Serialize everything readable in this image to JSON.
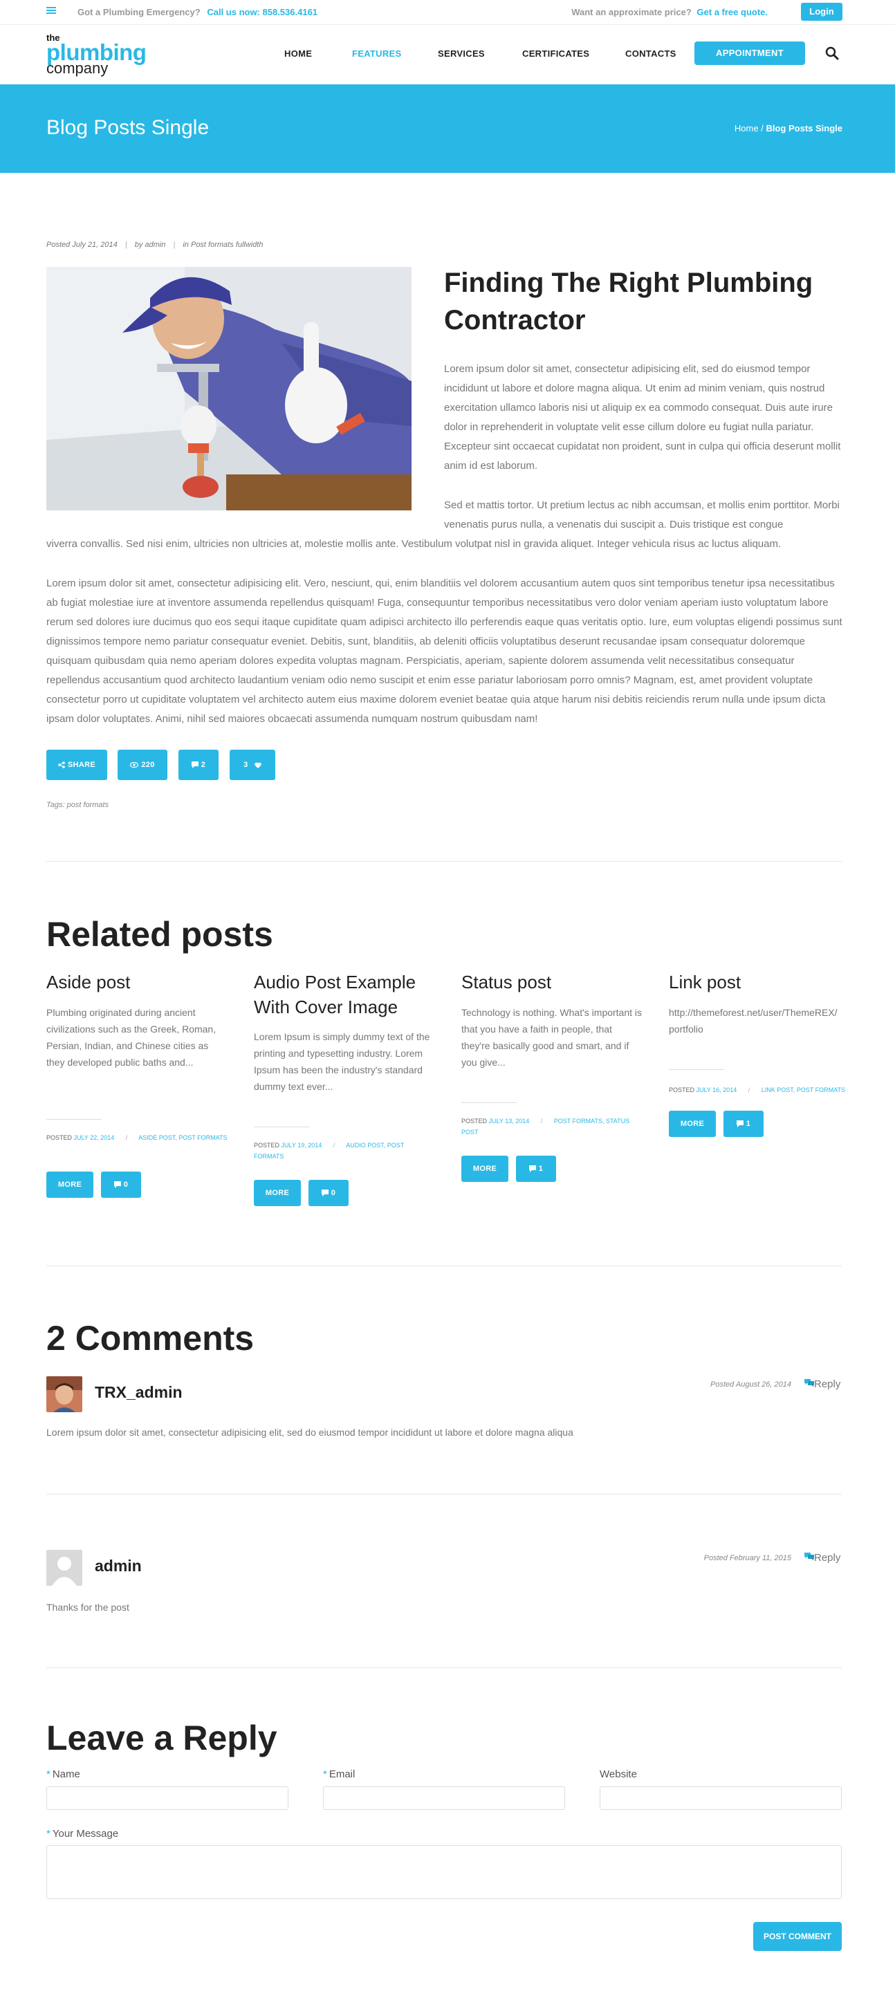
{
  "topbar": {
    "emergency_text": "Got a Plumbing Emergency?",
    "phone_text": "Call us now: 858.536.4161",
    "approx_text": "Want an approximate price?",
    "quote_text": "Get a free quote.",
    "login_label": "Login"
  },
  "logo": {
    "the": "the",
    "plumbing": "plumbing",
    "company": "company"
  },
  "nav": {
    "items": [
      {
        "label": "HOME"
      },
      {
        "label": "FEATURES",
        "active": true
      },
      {
        "label": "SERVICES"
      },
      {
        "label": "CERTIFICATES"
      },
      {
        "label": "CONTACTS"
      }
    ],
    "appointment_label": "APPOINTMENT"
  },
  "page_title": "Blog Posts Single",
  "breadcrumb": {
    "home": "Home",
    "separator": "/",
    "current": "Blog Posts Single"
  },
  "post": {
    "posted": "Posted July 21, 2014",
    "by": "by admin",
    "category": "in Post formats fullwidth",
    "title": "Finding The Right Plumbing Contractor",
    "p1": "Lorem ipsum dolor sit amet, consectetur adipisicing elit, sed do eiusmod tempor incididunt ut labore et dolore magna aliqua. Ut enim ad minim veniam, quis nostrud exercitation ullamco laboris nisi ut aliquip ex ea commodo consequat. Duis aute irure dolor in reprehenderit in voluptate velit esse cillum dolore eu fugiat nulla pariatur. Excepteur sint occaecat cupidatat non proident, sunt in culpa qui officia deserunt mollit anim id est laborum.",
    "p2a": "Sed et mattis tortor. Ut pretium lectus ac nibh accumsan, et mollis enim porttitor. Morbi venenatis purus nulla, a venenatis dui suscipit a. Duis tristique est congue",
    "p2b": "viverra convallis. Sed nisi enim, ultricies non ultricies at, molestie mollis ante. Vestibulum volutpat nisl in gravida aliquet. Integer vehicula risus ac luctus aliquam.",
    "p3": "Lorem ipsum dolor sit amet, consectetur adipisicing elit. Vero, nesciunt, qui, enim blanditiis vel dolorem accusantium autem quos sint temporibus tenetur ipsa necessitatibus ab fugiat molestiae iure at inventore assumenda repellendus quisquam! Fuga, consequuntur temporibus necessitatibus vero dolor veniam aperiam iusto voluptatum labore rerum sed dolores iure ducimus quo eos sequi itaque cupiditate quam adipisci architecto illo perferendis eaque quas veritatis optio. Iure, eum voluptas eligendi possimus sunt dignissimos tempore nemo pariatur consequatur eveniet. Debitis, sunt, blanditiis, ab deleniti officiis voluptatibus deserunt recusandae ipsam consequatur doloremque quisquam quibusdam quia nemo aperiam dolores expedita voluptas magnam. Perspiciatis, aperiam, sapiente dolorem assumenda velit necessitatibus consequatur repellendus accusantium quod architecto laudantium veniam odio nemo suscipit et enim esse pariatur laboriosam porro omnis? Magnam, est, amet provident voluptate consectetur porro ut cupiditate voluptatem vel architecto autem eius maxime dolorem eveniet beatae quia atque harum nisi debitis reiciendis rerum nulla unde ipsum dicta ipsam dolor voluptates. Animi, nihil sed maiores obcaecati assumenda numquam nostrum quibusdam nam!",
    "share_label": "SHARE",
    "views": "220",
    "comments": "2",
    "likes": "3",
    "tags_label": "Tags:",
    "tags": "post formats"
  },
  "related": {
    "title": "Related posts",
    "posts": [
      {
        "title": "Aside post",
        "excerpt": "Plumbing originated during ancient civilizations such as the Greek, Roman, Persian, Indian, and Chinese cities as they developed public baths and...",
        "posted_label": "POSTED",
        "date": "JULY 22, 2014",
        "cats": "ASIDE POST, POST FORMATS",
        "more": "MORE",
        "comments": "0"
      },
      {
        "title": "Audio Post Example With Cover Image",
        "excerpt": "Lorem Ipsum is simply dummy text of the printing and typesetting industry. Lorem Ipsum has been the industry's standard dummy text ever...",
        "posted_label": "POSTED",
        "date": "JULY 19, 2014",
        "cats": "AUDIO POST, POST FORMATS",
        "more": "MORE",
        "comments": "0"
      },
      {
        "title": "Status post",
        "excerpt": "Technology is nothing. What's important is that you have a faith in people, that they're basically good and smart, and if you give...",
        "posted_label": "POSTED",
        "date": "JULY 13, 2014",
        "cats": "POST FORMATS, STATUS POST",
        "more": "MORE",
        "comments": "1"
      },
      {
        "title": "Link post",
        "excerpt": "http://themeforest.net/user/ThemeREX/portfolio",
        "posted_label": "POSTED",
        "date": "JULY 16, 2014",
        "cats": "LINK POST, POST FORMATS",
        "more": "MORE",
        "comments": "1"
      }
    ]
  },
  "comments": {
    "title": "2 Comments",
    "items": [
      {
        "author": "TRX_admin",
        "date": "Posted August 26, 2014",
        "reply": "Reply",
        "text": "Lorem ipsum dolor sit amet, consectetur adipisicing elit, sed do eiusmod tempor incididunt ut labore et dolore magna aliqua"
      },
      {
        "author": "admin",
        "date": "Posted February 11, 2015",
        "reply": "Reply",
        "text": "Thanks for the post"
      }
    ]
  },
  "reply_form": {
    "title": "Leave a Reply",
    "required_mark": "*",
    "name_label": "Name",
    "email_label": "Email",
    "website_label": "Website",
    "message_label": "Your Message",
    "submit_label": "POST COMMENT"
  },
  "colors": {
    "accent": "#29b8e5",
    "heading": "#222222",
    "body_text": "#777777"
  }
}
